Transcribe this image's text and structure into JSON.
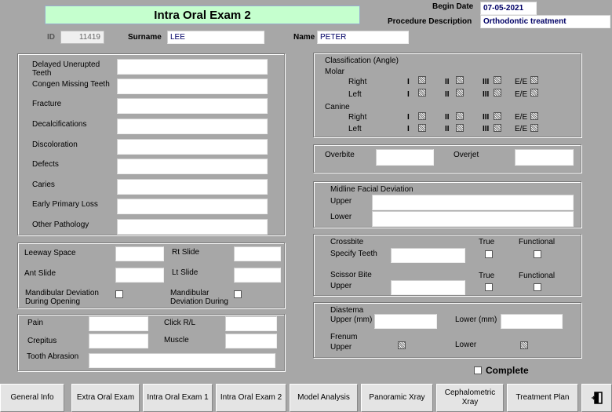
{
  "header": {
    "title": "Intra Oral Exam 2",
    "begin_date_label": "Begin Date",
    "begin_date_value": "07-05-2021",
    "procedure_label": "Procedure Description",
    "procedure_value": "Orthodontic treatment",
    "id_label": "ID",
    "id_value": "11419",
    "surname_label": "Surname",
    "surname_value": "LEE",
    "name_label": "Name",
    "name_value": "PETER"
  },
  "left_panel": {
    "fields": [
      "Delayed Unerupted Teeth",
      "Congen Missing Teeth",
      "Fracture",
      "Decalcifications",
      "Discoloration",
      "Defects",
      "Caries",
      "Early Primary Loss",
      "Other Pathology"
    ]
  },
  "leeway_panel": {
    "leeway_label": "Leeway Space",
    "rt_slide_label": "Rt Slide",
    "ant_slide_label": "Ant Slide",
    "lt_slide_label": "Lt Slide",
    "mand_open_label": "Mandibular Deviation During Opening",
    "mand_during_label": "Mandibular Deviation During"
  },
  "tmj_panel": {
    "pain_label": "Pain",
    "click_label": "Click R/L",
    "crepitus_label": "Crepitus",
    "muscle_label": "Muscle",
    "abrasion_label": "Tooth Abrasion"
  },
  "classification": {
    "title": "Classification (Angle)",
    "molar_label": "Molar",
    "canine_label": "Canine",
    "right_label": "Right",
    "left_label": "Left",
    "class_i": "I",
    "class_ii": "II",
    "class_iii": "III",
    "ee": "E/E"
  },
  "overbite": {
    "overbite_label": "Overbite",
    "overjet_label": "Overjet"
  },
  "midline": {
    "title": "Midline Facial Deviation",
    "upper_label": "Upper",
    "lower_label": "Lower"
  },
  "crossbite": {
    "crossbite_label": "Crossbite",
    "true_label": "True",
    "functional_label": "Functional",
    "specify_label": "Specify Teeth",
    "scissor_label": "Scissor Bite",
    "upper_label": "Upper"
  },
  "diastema": {
    "title": "Diastema",
    "upper_mm_label": "Upper (mm)",
    "lower_mm_label": "Lower (mm)",
    "frenum_label": "Frenum",
    "upper_label": "Upper",
    "lower_label": "Lower"
  },
  "complete_label": "Complete",
  "tabs": [
    "General Info",
    "Extra Oral Exam",
    "Intra Oral Exam 1",
    "Intra Oral Exam 2",
    "Model Analysis",
    "Panoramic Xray",
    "Cephalometric Xray",
    "Treatment Plan"
  ],
  "exit_icon": "exit-door-icon"
}
